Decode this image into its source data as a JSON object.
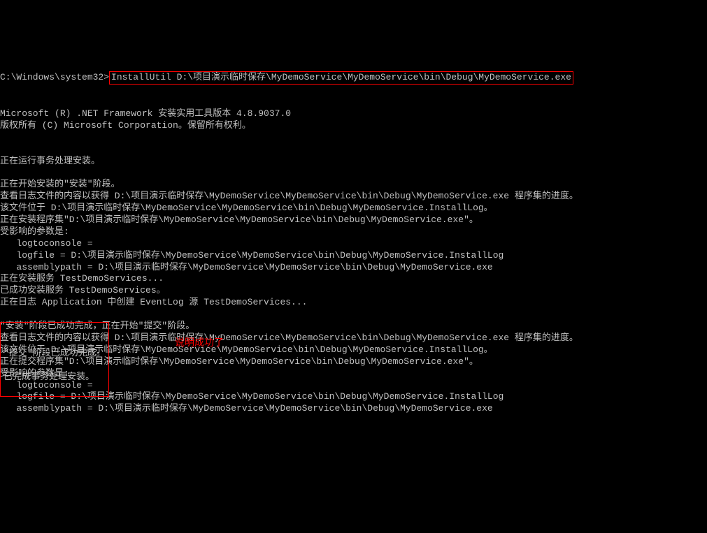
{
  "terminal": {
    "prompt": "C:\\Windows\\system32>",
    "command": "InstallUtil D:\\项目演示临时保存\\MyDemoService\\MyDemoService\\bin\\Debug\\MyDemoService.exe",
    "lines": [
      "Microsoft (R) .NET Framework 安装实用工具版本 4.8.9037.0",
      "版权所有 (C) Microsoft Corporation。保留所有权利。",
      "",
      "",
      "正在运行事务处理安装。",
      "",
      "正在开始安装的\"安装\"阶段。",
      "查看日志文件的内容以获得 D:\\项目演示临时保存\\MyDemoService\\MyDemoService\\bin\\Debug\\MyDemoService.exe 程序集的进度。",
      "该文件位于 D:\\项目演示临时保存\\MyDemoService\\MyDemoService\\bin\\Debug\\MyDemoService.InstallLog。",
      "正在安装程序集\"D:\\项目演示临时保存\\MyDemoService\\MyDemoService\\bin\\Debug\\MyDemoService.exe\"。",
      "受影响的参数是:",
      "   logtoconsole =",
      "   logfile = D:\\项目演示临时保存\\MyDemoService\\MyDemoService\\bin\\Debug\\MyDemoService.InstallLog",
      "   assemblypath = D:\\项目演示临时保存\\MyDemoService\\MyDemoService\\bin\\Debug\\MyDemoService.exe",
      "正在安装服务 TestDemoServices...",
      "已成功安装服务 TestDemoServices。",
      "正在日志 Application 中创建 EventLog 源 TestDemoServices...",
      "",
      "\"安装\"阶段已成功完成，正在开始\"提交\"阶段。",
      "查看日志文件的内容以获得 D:\\项目演示临时保存\\MyDemoService\\MyDemoService\\bin\\Debug\\MyDemoService.exe 程序集的进度。",
      "该文件位于 D:\\项目演示临时保存\\MyDemoService\\MyDemoService\\bin\\Debug\\MyDemoService.InstallLog。",
      "正在提交程序集\"D:\\项目演示临时保存\\MyDemoService\\MyDemoService\\bin\\Debug\\MyDemoService.exe\"。",
      "受影响的参数是:",
      "   logtoconsole =",
      "   logfile = D:\\项目演示临时保存\\MyDemoService\\MyDemoService\\bin\\Debug\\MyDemoService.InstallLog",
      "   assemblypath = D:\\项目演示临时保存\\MyDemoService\\MyDemoService\\bin\\Debug\\MyDemoService.exe"
    ],
    "success_lines": [
      "\"提交\"阶段已成功完成。",
      "",
      "已完成事务处理安装。"
    ],
    "annotation": "说明成功了"
  }
}
